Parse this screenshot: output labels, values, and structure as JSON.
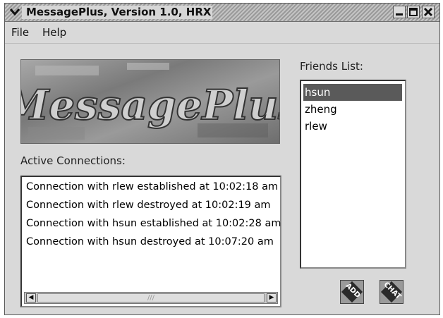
{
  "window": {
    "title": "MessagePlus, Version 1.0, HRX"
  },
  "menu": {
    "file": "File",
    "help": "Help"
  },
  "logo": {
    "text": "MessagePlus"
  },
  "connections": {
    "label": "Active Connections:",
    "lines": [
      "Connection with rlew established at 10:02:18 am",
      "Connection with rlew destroyed at 10:02:19 am",
      "Connection with hsun established at 10:02:28 am",
      "Connection with hsun destroyed at 10:07:20 am"
    ]
  },
  "friends": {
    "label": "Friends List:",
    "items": [
      "hsun",
      "zheng",
      "rlew"
    ],
    "selected": "hsun"
  },
  "buttons": {
    "add": "ADD",
    "chat": "CHAT"
  }
}
